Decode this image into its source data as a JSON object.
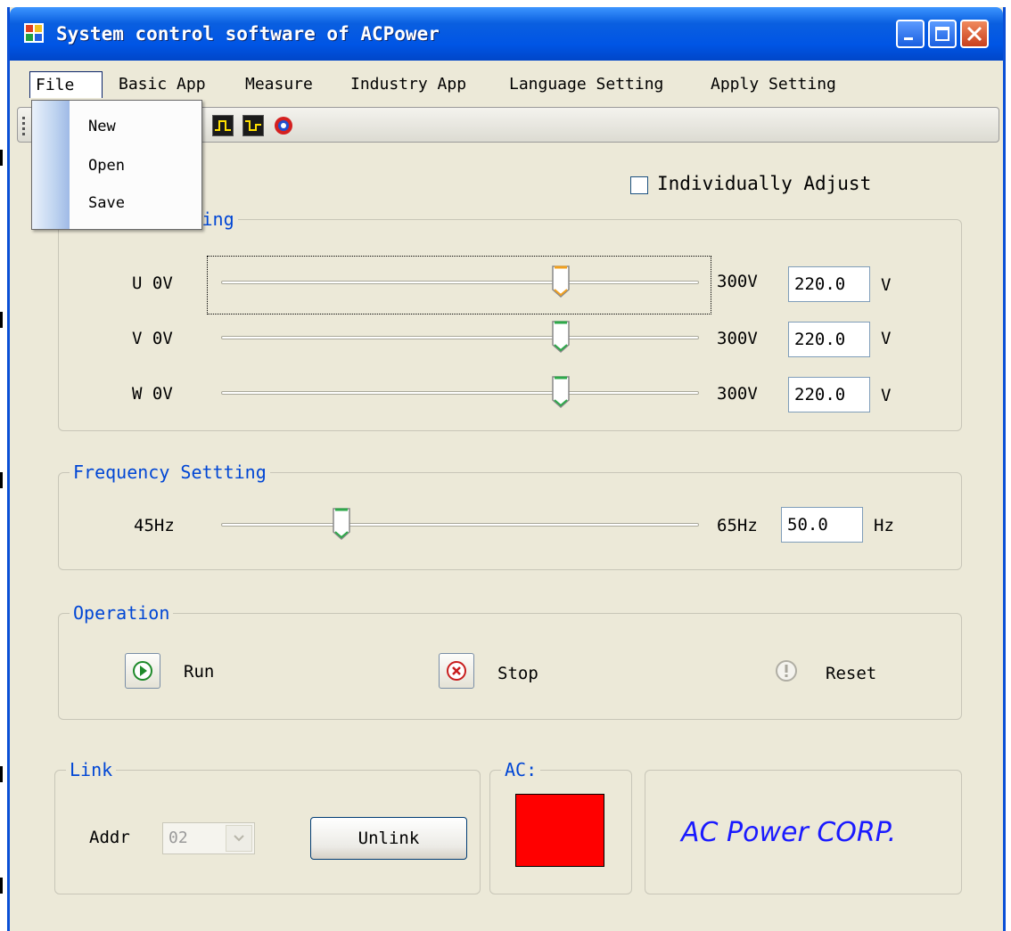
{
  "window": {
    "title": "System control software of ACPower",
    "accent_color": "#0055e5"
  },
  "menubar": {
    "items": [
      "File",
      "Basic App",
      "Measure",
      "Industry App",
      "Language Setting",
      "Apply Setting"
    ]
  },
  "file_menu": {
    "items": [
      "New",
      "Open",
      "Save"
    ]
  },
  "toolbar": {
    "icons": [
      "pulse-rise-icon",
      "pulse-fall-icon",
      "power-cycle-icon"
    ]
  },
  "individually_adjust": {
    "label": "Individually Adjust",
    "checked": false
  },
  "voltage": {
    "title": "Voltage Setting",
    "unit": "V",
    "max_label": "300V",
    "rows": [
      {
        "label": "U 0V",
        "value": "220.0",
        "unit": "V",
        "level": 0.733
      },
      {
        "label": "V 0V",
        "value": "220.0",
        "unit": "V",
        "level": 0.733
      },
      {
        "label": "W 0V",
        "value": "220.0",
        "unit": "V",
        "level": 0.733
      }
    ]
  },
  "frequency": {
    "title": "Frequency Settting",
    "min_label": "45Hz",
    "max_label": "65Hz",
    "value": "50.0",
    "unit": "Hz",
    "level": 0.25
  },
  "operation": {
    "title": "Operation",
    "run_label": "Run",
    "stop_label": "Stop",
    "reset_label": "Reset"
  },
  "link": {
    "title": "Link",
    "addr_label": "Addr",
    "addr_value": "02",
    "unlink_label": "Unlink"
  },
  "ac": {
    "title": "AC:",
    "status_color": "#ff0000"
  },
  "brand": {
    "text": "AC Power CORP."
  }
}
